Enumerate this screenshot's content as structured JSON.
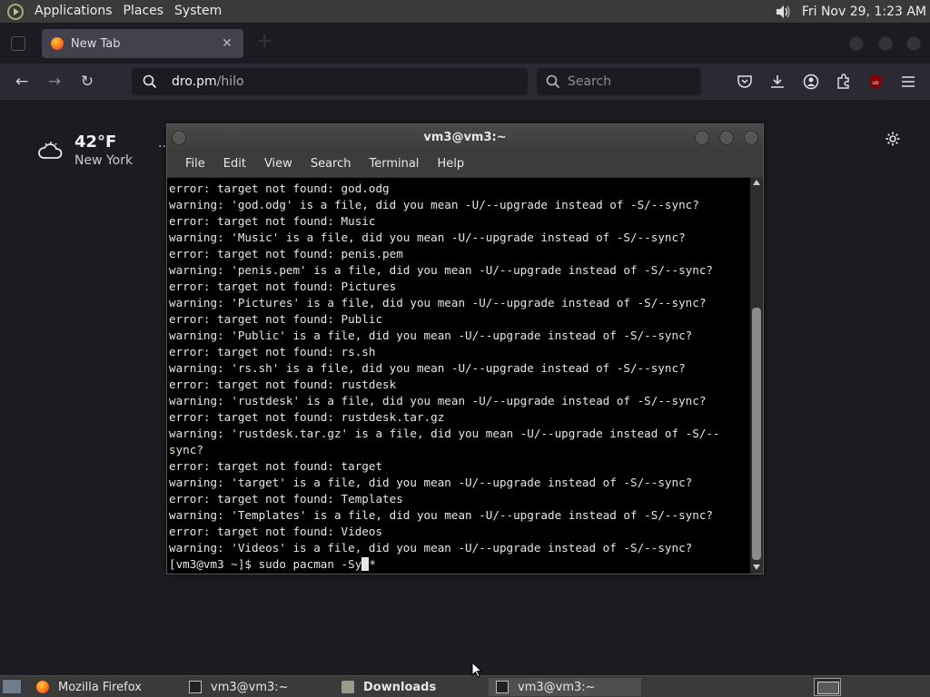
{
  "top_panel": {
    "menus": [
      "Applications",
      "Places",
      "System"
    ],
    "clock": "Fri Nov 29,  1:23 AM"
  },
  "firefox": {
    "tab": {
      "label": "New Tab",
      "close": "✕"
    },
    "nav": {
      "back": "←",
      "forward": "→",
      "reload": "↻"
    },
    "url_host": "dro.pm",
    "url_path": "/hilo",
    "search_placeholder": "Search"
  },
  "newtab": {
    "weather_temp": "42°F",
    "weather_city": "New York",
    "weather_more": "··"
  },
  "terminal": {
    "title": "vm3@vm3:~",
    "menu": [
      "File",
      "Edit",
      "View",
      "Search",
      "Terminal",
      "Help"
    ],
    "lines": [
      "error: target not found: god.odg",
      "warning: 'god.odg' is a file, did you mean -U/--upgrade instead of -S/--sync?",
      "error: target not found: Music",
      "warning: 'Music' is a file, did you mean -U/--upgrade instead of -S/--sync?",
      "error: target not found: penis.pem",
      "warning: 'penis.pem' is a file, did you mean -U/--upgrade instead of -S/--sync?",
      "error: target not found: Pictures",
      "warning: 'Pictures' is a file, did you mean -U/--upgrade instead of -S/--sync?",
      "error: target not found: Public",
      "warning: 'Public' is a file, did you mean -U/--upgrade instead of -S/--sync?",
      "error: target not found: rs.sh",
      "warning: 'rs.sh' is a file, did you mean -U/--upgrade instead of -S/--sync?",
      "error: target not found: rustdesk",
      "warning: 'rustdesk' is a file, did you mean -U/--upgrade instead of -S/--sync?",
      "error: target not found: rustdesk.tar.gz",
      "warning: 'rustdesk.tar.gz' is a file, did you mean -U/--upgrade instead of -S/--",
      "sync?",
      "error: target not found: target",
      "warning: 'target' is a file, did you mean -U/--upgrade instead of -S/--sync?",
      "error: target not found: Templates",
      "warning: 'Templates' is a file, did you mean -U/--upgrade instead of -S/--sync?",
      "error: target not found: Videos",
      "warning: 'Videos' is a file, did you mean -U/--upgrade instead of -S/--sync?"
    ],
    "prompt": "[vm3@vm3 ~]$ sudo pacman -Sy",
    "after_cursor": "*"
  },
  "taskbar": {
    "items": [
      "Mozilla Firefox",
      "vm3@vm3:~",
      "Downloads",
      "vm3@vm3:~"
    ]
  },
  "colors": {
    "panel": "#3a3a3a",
    "firefox_bg": "#1c1b22",
    "toolbar": "#2b2a33",
    "terminal_bg": "#000000"
  }
}
